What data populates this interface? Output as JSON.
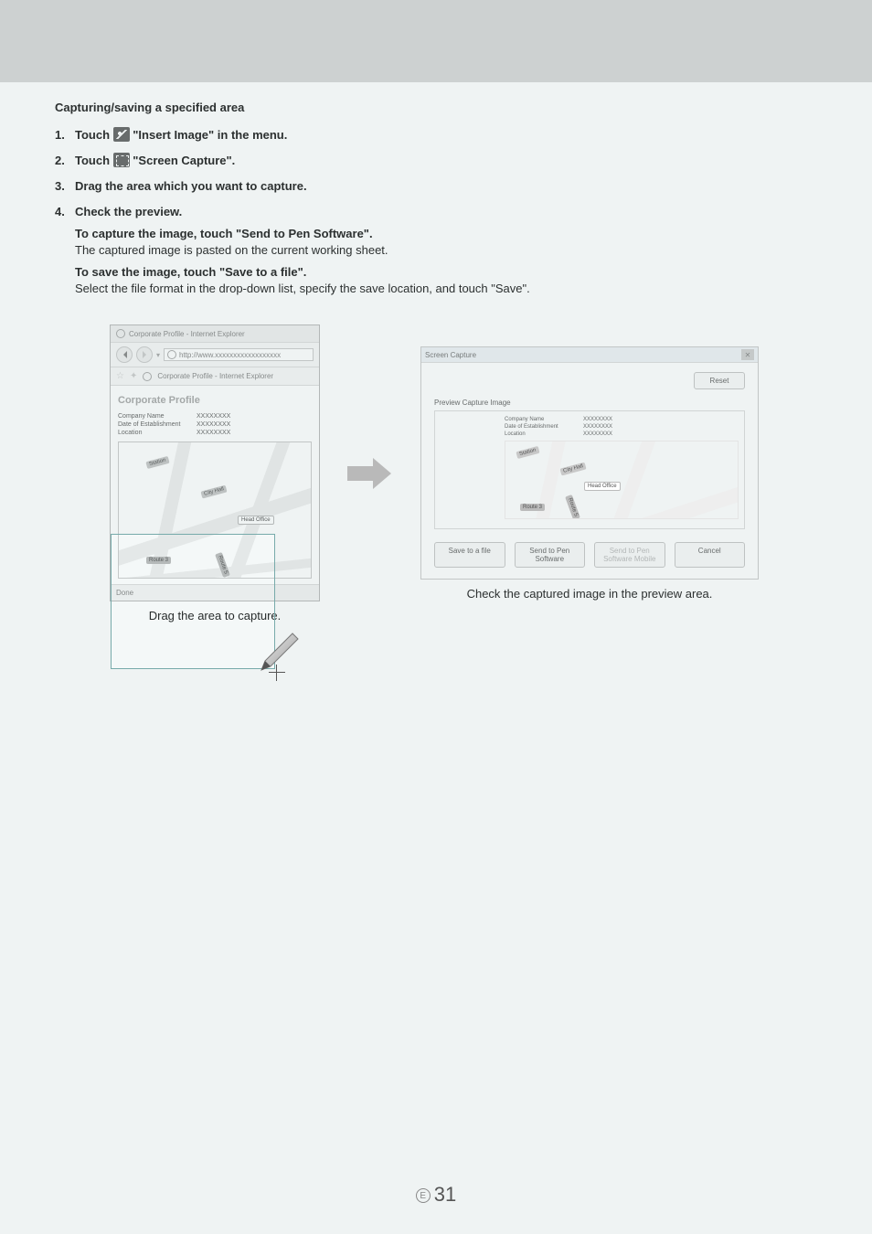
{
  "section_title": "Capturing/saving a specified area",
  "steps": {
    "s1_a": "Touch ",
    "s1_b": " \"Insert Image\" in the menu.",
    "s2_a": "Touch ",
    "s2_b": " \"Screen Capture\".",
    "s3": "Drag the area which you want to capture.",
    "s4": "Check the preview.",
    "s4_sub1_bold": "To capture the image, touch \"Send to Pen Software\".",
    "s4_sub1_text": "The captured image is pasted on the current working sheet.",
    "s4_sub2_bold": "To save the image, touch \"Save to a file\".",
    "s4_sub2_text": "Select the file format in the drop-down list, specify the save location, and touch \"Save\"."
  },
  "browser": {
    "window_title": "Corporate Profile - Internet Explorer",
    "url": "http://www.xxxxxxxxxxxxxxxxxx",
    "tab_title": "Corporate Profile - Internet Explorer",
    "heading": "Corporate Profile",
    "rows": {
      "company_label": "Company Name",
      "company_value": "XXXXXXXX",
      "date_label": "Date of Establishment",
      "date_value": "XXXXXXXX",
      "location_label": "Location",
      "location_value": "XXXXXXXX"
    },
    "map_labels": {
      "station": "Station",
      "city_hall": "City Hall",
      "head_office": "Head Office",
      "route3": "Route 3",
      "route5": "Route 5"
    },
    "status": "Done"
  },
  "left_caption": "Drag the area to capture.",
  "dialog": {
    "title": "Screen Capture",
    "reset": "Reset",
    "preview_label": "Preview Capture Image",
    "save": "Save to a file",
    "send": "Send to Pen Software",
    "send_mobile": "Send to Pen Software Mobile",
    "cancel": "Cancel"
  },
  "right_caption": "Check the captured image in the preview area.",
  "page_number": "31",
  "page_marker": "E"
}
